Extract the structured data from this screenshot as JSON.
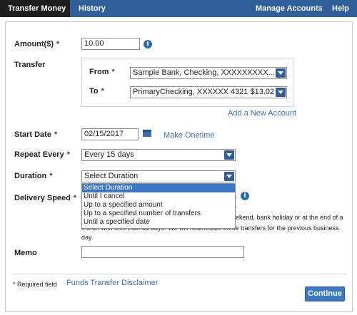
{
  "nav": {
    "active_tab": "Transfer Money",
    "history": "History",
    "manage_accounts": "Manage Accounts",
    "help": "Help"
  },
  "form": {
    "required_marker": "*",
    "amount": {
      "label": "Amount($)",
      "value": "10.00"
    },
    "transfer": {
      "label": "Transfer",
      "from_label": "From",
      "from_value": "Sample Bank, Checking, XXXXXXXXX...",
      "to_label": "To",
      "to_value": "PrimaryChecking, XXXXXX 4321 $13.02",
      "add_account_link": "Add a New Account"
    },
    "start_date": {
      "label": "Start Date",
      "value": "02/15/2017",
      "make_onetime_link": "Make Onetime"
    },
    "repeat_every": {
      "label": "Repeat Every",
      "value": "Every 15 days"
    },
    "duration": {
      "label": "Duration",
      "value": "Select Duration",
      "options": [
        "Select Duration",
        "Until I cancel",
        "Up to a specified amount",
        "Up to a specified number of transfers",
        "Until a specified date"
      ]
    },
    "delivery_speed": {
      "label": "Delivery Speed",
      "hint_line1_fragment": "e",
      "hint_line2_fragment": "e",
      "note_line1": "ekend, bank holiday or at the end of a",
      "note_line2": "month with less than 31 days. We will reschedule these transfers for the previous business day."
    },
    "memo": {
      "label": "Memo",
      "value": ""
    }
  },
  "footer": {
    "required_field_note": "* Required field",
    "disclaimer_link": "Funds Transfer Disclaimer",
    "continue_button": "Continue"
  },
  "colors": {
    "nav_bg": "#2f5f9a",
    "active_tab_bg": "#1e1e1e",
    "link": "#3a72b5",
    "button": "#3b79c4",
    "dropdown_selected": "#3b77c9"
  }
}
